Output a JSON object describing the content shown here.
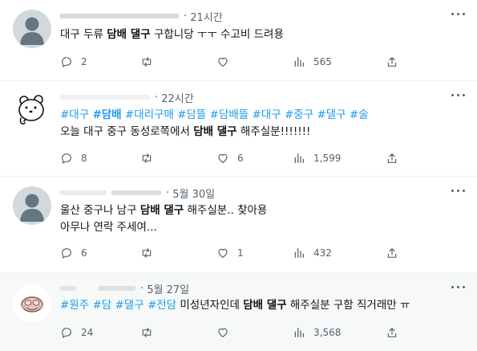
{
  "tweets": [
    {
      "time": "21시간",
      "text_a": "대구 두류 ",
      "text_bold": "담배 댈구",
      "text_b": " 구합니당 ㅜㅜ 수고비 드려용",
      "replies": "2",
      "retweets": "",
      "likes": "",
      "views": "565"
    },
    {
      "time": "22시간",
      "tags": [
        "#대구",
        "#담배",
        "#대리구매",
        "#담뜰",
        "#담배뜰",
        "#대구",
        "#중구",
        "#댈구",
        "#술"
      ],
      "text_a": "오늘 대구 중구 동성로쪽에서 ",
      "text_bold": "담배 댈구",
      "text_b": " 해주실분!!!!!!!",
      "replies": "8",
      "retweets": "",
      "likes": "6",
      "views": "1,599"
    },
    {
      "time": "5월 30일",
      "text_a": "울산 중구나 남구 ",
      "text_bold": "담배 댈구",
      "text_b": " 해주실분.. 찾아용",
      "line2": "아무나 연락 주세여...",
      "replies": "6",
      "retweets": "",
      "likes": "1",
      "views": "432"
    },
    {
      "time": "5월 27일",
      "tags": [
        "#원주",
        "#담",
        "#댈구",
        "#전담"
      ],
      "text_a": "미성년자인데 ",
      "text_bold": "담배 댈구",
      "text_b": " 해주실분 구함 직거래만 ㅠ",
      "replies": "24",
      "retweets": "",
      "likes": "",
      "views": "3,568"
    }
  ],
  "icons": {
    "reply": "reply-icon",
    "retweet": "retweet-icon",
    "like": "heart-icon",
    "views": "views-icon",
    "share": "share-icon",
    "more": "more-icon"
  },
  "colors": {
    "hashtag": "#1d9bf0",
    "muted": "#536471",
    "avatar_default": "#cfd9de",
    "highlight_bg": "#f7f9f9"
  }
}
